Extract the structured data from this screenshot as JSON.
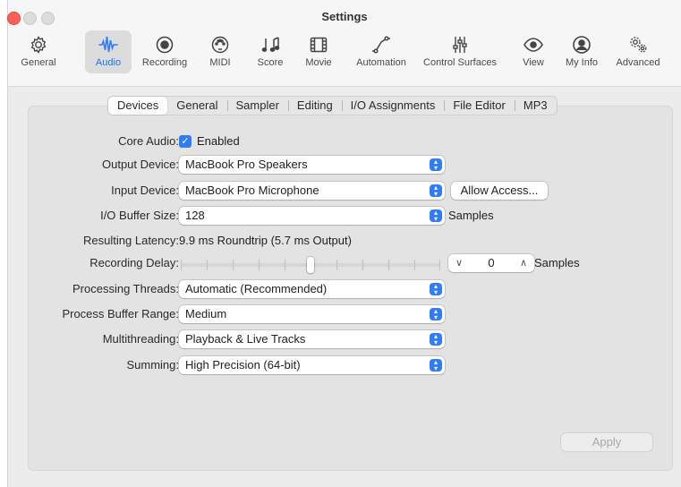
{
  "window": {
    "title": "Settings"
  },
  "toolbar": [
    {
      "label": "General",
      "icon": "gear-icon"
    },
    {
      "label": "Audio",
      "icon": "waveform-icon",
      "active": true
    },
    {
      "label": "Recording",
      "icon": "record-icon"
    },
    {
      "label": "MIDI",
      "icon": "midi-port-icon"
    },
    {
      "label": "Score",
      "icon": "music-notes-icon"
    },
    {
      "label": "Movie",
      "icon": "film-icon"
    },
    {
      "label": "Automation",
      "icon": "automation-curve-icon"
    },
    {
      "label": "Control Surfaces",
      "icon": "faders-icon"
    },
    {
      "label": "View",
      "icon": "eye-icon"
    },
    {
      "label": "My Info",
      "icon": "person-icon"
    },
    {
      "label": "Advanced",
      "icon": "gears-icon"
    }
  ],
  "tabs": [
    "Devices",
    "General",
    "Sampler",
    "Editing",
    "I/O Assignments",
    "File Editor",
    "MP3"
  ],
  "active_tab": "Devices",
  "form": {
    "core_audio": {
      "label": "Core Audio:",
      "value": "Enabled",
      "checked": true
    },
    "output_device": {
      "label": "Output Device:",
      "value": "MacBook Pro Speakers"
    },
    "input_device": {
      "label": "Input Device:",
      "value": "MacBook Pro Microphone",
      "button": "Allow Access..."
    },
    "io_buffer": {
      "label": "I/O Buffer Size:",
      "value": "128",
      "unit": "Samples"
    },
    "latency": {
      "label": "Resulting Latency:",
      "value": "9.9 ms Roundtrip (5.7 ms Output)"
    },
    "recording_delay": {
      "label": "Recording Delay:",
      "value": "0",
      "unit": "Samples",
      "slider_position": 0.5
    },
    "processing_threads": {
      "label": "Processing Threads:",
      "value": "Automatic (Recommended)"
    },
    "process_buffer": {
      "label": "Process Buffer Range:",
      "value": "Medium"
    },
    "multithreading": {
      "label": "Multithreading:",
      "value": "Playback & Live Tracks"
    },
    "summing": {
      "label": "Summing:",
      "value": "High Precision (64-bit)"
    }
  },
  "apply_button": "Apply",
  "colors": {
    "accent": "#2f7cf6",
    "close": "#fe5f57"
  }
}
